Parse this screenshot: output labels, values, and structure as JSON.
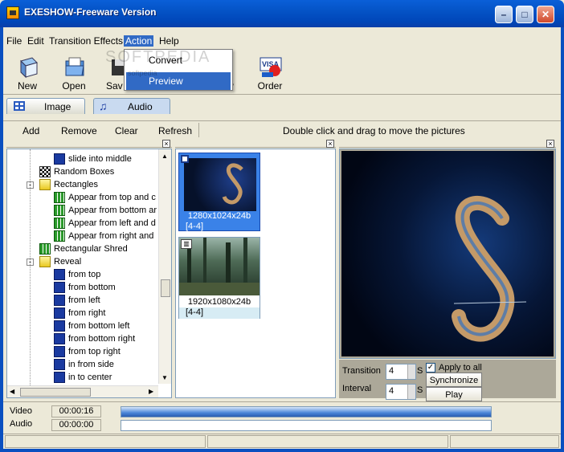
{
  "window": {
    "title": "EXESHOW-Freeware Version"
  },
  "menu": {
    "file": "File",
    "edit": "Edit",
    "transition_effects": "Transition Effects",
    "action": "Action",
    "help": "Help"
  },
  "action_menu": {
    "convert": "Convert",
    "preview": "Preview",
    "watermark": "SOFTPEDIA",
    "watermark_small": "softpedia"
  },
  "toolbar": {
    "new": "New",
    "open": "Open",
    "save": "Sav",
    "view": "w",
    "order": "Order"
  },
  "tabs": {
    "image": "Image",
    "audio": "Audio"
  },
  "actions": {
    "add": "Add",
    "remove": "Remove",
    "clear": "Clear",
    "refresh": "Refresh",
    "hint": "Double click and drag to move the pictures"
  },
  "tree": [
    {
      "label": "slide into middle",
      "indent": 2,
      "icon": "blue-square"
    },
    {
      "label": "Random Boxes",
      "indent": 1,
      "icon": "checker"
    },
    {
      "label": "Rectangles",
      "indent": 1,
      "icon": "folder",
      "toggle": "-"
    },
    {
      "label": "Appear from top and c",
      "indent": 2,
      "icon": "green-grid"
    },
    {
      "label": "Appear from bottom ar",
      "indent": 2,
      "icon": "green-grid"
    },
    {
      "label": "Appear from left and d",
      "indent": 2,
      "icon": "green-grid"
    },
    {
      "label": "Appear from right and",
      "indent": 2,
      "icon": "green-grid"
    },
    {
      "label": "Rectangular Shred",
      "indent": 1,
      "icon": "green-grid"
    },
    {
      "label": "Reveal",
      "indent": 1,
      "icon": "folder",
      "toggle": "-"
    },
    {
      "label": "from top",
      "indent": 2,
      "icon": "blue-square"
    },
    {
      "label": "from bottom",
      "indent": 2,
      "icon": "blue-square"
    },
    {
      "label": "from left",
      "indent": 2,
      "icon": "blue-square"
    },
    {
      "label": "from right",
      "indent": 2,
      "icon": "blue-square"
    },
    {
      "label": "from bottom left",
      "indent": 2,
      "icon": "blue-square"
    },
    {
      "label": "from bottom right",
      "indent": 2,
      "icon": "blue-square"
    },
    {
      "label": "from top right",
      "indent": 2,
      "icon": "blue-square"
    },
    {
      "label": "in from side",
      "indent": 2,
      "icon": "blue-square"
    },
    {
      "label": "in to center",
      "indent": 2,
      "icon": "blue-square"
    }
  ],
  "thumbs": [
    {
      "size": "1280x1024x24b",
      "range": "[4-4]",
      "selected": true
    },
    {
      "size": "1920x1080x24b",
      "range": "[4-4]",
      "selected": false
    }
  ],
  "controls": {
    "transition_label": "Transition",
    "transition_value": "4",
    "transition_unit": "S",
    "interval_label": "Interval",
    "interval_value": "4",
    "interval_unit": "S",
    "apply_all": "Apply to all",
    "apply_all_checked": true,
    "synchronize": "Synchronize",
    "play": "Play"
  },
  "status": {
    "video_label": "Video",
    "video_time": "00:00:16",
    "audio_label": "Audio",
    "audio_time": "00:00:00"
  },
  "colors": {
    "titlebar": "#0453c6",
    "selection": "#316ac5",
    "preview_bg": "#001030"
  }
}
